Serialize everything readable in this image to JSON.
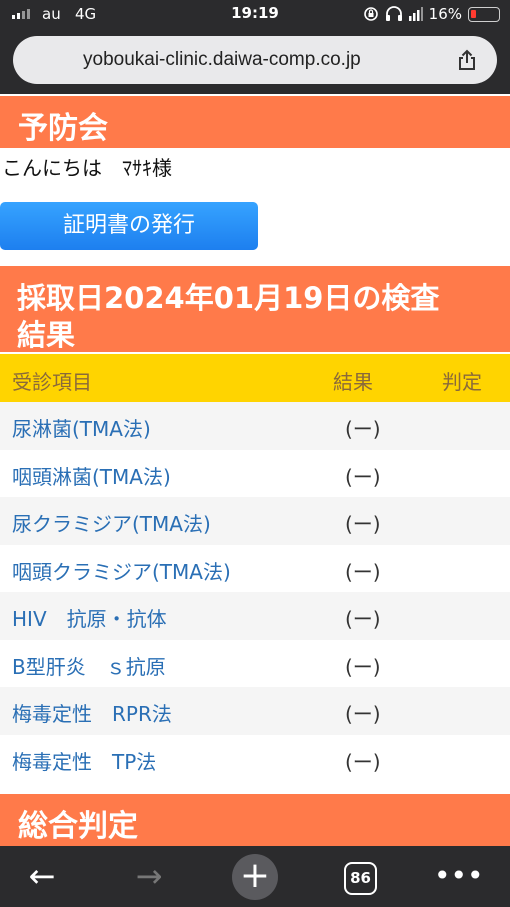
{
  "status": {
    "carrier": "au",
    "network": "4G",
    "time": "19:19",
    "battery_text": "16%"
  },
  "browser": {
    "url": "yoboukai-clinic.daiwa-comp.co.jp",
    "share_icon": "share-icon",
    "tab_count": "86",
    "back_glyph": "←",
    "forward_glyph": "→",
    "new_tab_glyph": "+",
    "menu_glyph": "•••"
  },
  "page": {
    "brand_header": "予防会",
    "greeting": "こんにちは　ﾏｻｷ様",
    "certificate_button": "証明書の発行",
    "date_header_line1": "採取日2024年01月19日の検査",
    "date_header_line2": "結果",
    "summary_header": "総合判定"
  },
  "table": {
    "headers": {
      "item": "受診項目",
      "result": "結果",
      "judgement": "判定"
    },
    "rows": [
      {
        "name": "尿淋菌(TMA法)",
        "result": "(ー)"
      },
      {
        "name": "咽頭淋菌(TMA法)",
        "result": "(ー)"
      },
      {
        "name": "尿クラミジア(TMA法)",
        "result": "(ー)"
      },
      {
        "name": "咽頭クラミジア(TMA法)",
        "result": "(ー)"
      },
      {
        "name": "HIV　抗原・抗体",
        "result": "(ー)"
      },
      {
        "name": "B型肝炎　ｓ抗原",
        "result": "(ー)"
      },
      {
        "name": "梅毒定性　RPR法",
        "result": "(ー)"
      },
      {
        "name": "梅毒定性　TP法",
        "result": "(ー)"
      }
    ]
  },
  "colors": {
    "header_orange": "#ff7a4a",
    "table_header_yellow": "#ffd400",
    "link_blue": "#2a6fb5",
    "button_blue": "#1d7fef",
    "browser_chrome": "#2b2b2d"
  }
}
